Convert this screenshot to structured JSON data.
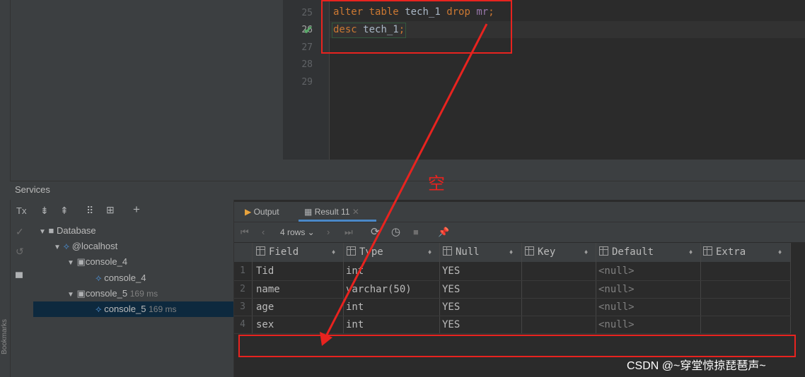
{
  "editor": {
    "line_numbers": [
      "25",
      "26",
      "27",
      "28",
      "29"
    ],
    "line25": {
      "kw1": "alter",
      "kw2": "table",
      "id": "tech_1",
      "kw3": "drop",
      "col": "mr",
      "semi": ";"
    },
    "line26": {
      "kw1": "desc",
      "id": "tech_1",
      "semi": ";"
    }
  },
  "annotation": {
    "text": "空",
    "color": "#e8231f"
  },
  "services": {
    "title": "Services",
    "toolbar": {
      "tx": "Tx",
      "expand": "⇟",
      "collapse": "⇞",
      "group": "⠿",
      "new_tab": "⊞",
      "add": "+"
    },
    "tree": [
      {
        "label": "Database"
      },
      {
        "label": "@localhost"
      },
      {
        "label": "console_4"
      },
      {
        "label": "console_4"
      },
      {
        "label": "console_5",
        "time": "169 ms"
      },
      {
        "label": "console_5",
        "time": "169 ms"
      }
    ]
  },
  "results": {
    "tabs": {
      "output": "Output",
      "result": "Result 11"
    },
    "rows_label": "4 rows",
    "columns": [
      "Field",
      "Type",
      "Null",
      "Key",
      "Default",
      "Extra"
    ],
    "rows": [
      {
        "n": "1",
        "field": "Tid",
        "type": "int",
        "null": "YES",
        "key": "",
        "default": "<null>",
        "extra": ""
      },
      {
        "n": "2",
        "field": "name",
        "type": "varchar(50)",
        "null": "YES",
        "key": "",
        "default": "<null>",
        "extra": ""
      },
      {
        "n": "3",
        "field": "age",
        "type": "int",
        "null": "YES",
        "key": "",
        "default": "<null>",
        "extra": ""
      },
      {
        "n": "4",
        "field": "sex",
        "type": "int",
        "null": "YES",
        "key": "",
        "default": "<null>",
        "extra": ""
      }
    ]
  },
  "sidebar": {
    "bookmarks": "Bookmarks"
  },
  "watermark": "CSDN @~穿堂惊掠琵琶声~"
}
